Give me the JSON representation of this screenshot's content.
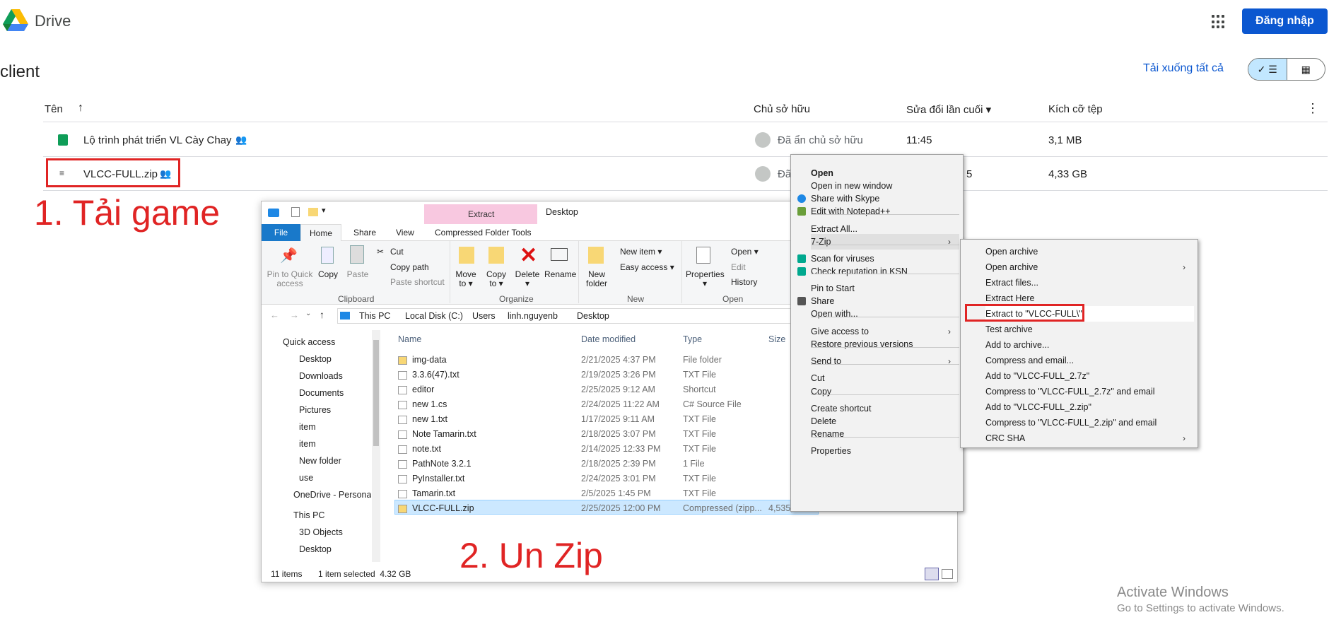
{
  "drive": {
    "brand": "Drive",
    "login": "Đăng nhập",
    "folder_title": "client",
    "download_all": "Tải xuống tất cả",
    "view_list_icon": "✓ ☰",
    "view_grid_icon": "▦"
  },
  "table": {
    "headers": {
      "name": "Tên",
      "sort_arrow": "↑",
      "owner": "Chủ sở hữu",
      "modified": "Sửa đổi lần cuối ▾",
      "size": "Kích cỡ tệp",
      "more": "⋮"
    },
    "rows": [
      {
        "name": "Lộ trình phát triển VL Cày Chay",
        "owner": "Đã ẩn chủ sở hữu",
        "modified": "11:45",
        "size": "3,1 MB"
      },
      {
        "name": "VLCC-FULL.zip",
        "owner": "Đã",
        "modified": "5",
        "size": "4,33 GB"
      }
    ]
  },
  "annotations": {
    "step1": "1. Tải game",
    "step2": "2. Un Zip"
  },
  "explorer": {
    "title": "Desktop",
    "extract_context": "Extract",
    "tabs": [
      "File",
      "Home",
      "Share",
      "View",
      "Compressed Folder Tools"
    ],
    "ribbon": {
      "pin": "Pin to Quick access",
      "copy": "Copy",
      "paste": "Paste",
      "cut": "Cut",
      "copy_path": "Copy path",
      "paste_shortcut": "Paste shortcut",
      "clipboard": "Clipboard",
      "move_to": "Move to ▾",
      "copy_to": "Copy to ▾",
      "delete": "Delete ▾",
      "rename": "Rename",
      "organize": "Organize",
      "new_folder": "New folder",
      "new_item": "New item ▾",
      "easy_access": "Easy access ▾",
      "new": "New",
      "properties": "Properties ▾",
      "open": "Open ▾",
      "edit": "Edit",
      "history": "History",
      "open_group": "Open"
    },
    "address": [
      "This PC",
      "Local Disk (C:)",
      "Users",
      "linh.nguyenb",
      "Desktop"
    ],
    "nav": [
      "Quick access",
      "Desktop",
      "Downloads",
      "Documents",
      "Pictures",
      "item",
      "item",
      "New folder",
      "use",
      "OneDrive - Personal",
      "This PC",
      "3D Objects",
      "Desktop"
    ],
    "columns": {
      "name": "Name",
      "date": "Date modified",
      "type": "Type",
      "size": "Size"
    },
    "files": [
      {
        "name": "img-data",
        "date": "2/21/2025 4:37 PM",
        "type": "File folder",
        "size": ""
      },
      {
        "name": "3.3.6(47).txt",
        "date": "2/19/2025 3:26 PM",
        "type": "TXT File",
        "size": ""
      },
      {
        "name": "editor",
        "date": "2/25/2025 9:12 AM",
        "type": "Shortcut",
        "size": ""
      },
      {
        "name": "new 1.cs",
        "date": "2/24/2025 11:22 AM",
        "type": "C# Source File",
        "size": ""
      },
      {
        "name": "new 1.txt",
        "date": "1/17/2025 9:11 AM",
        "type": "TXT File",
        "size": ""
      },
      {
        "name": "Note Tamarin.txt",
        "date": "2/18/2025 3:07 PM",
        "type": "TXT File",
        "size": ""
      },
      {
        "name": "note.txt",
        "date": "2/14/2025 12:33 PM",
        "type": "TXT File",
        "size": ""
      },
      {
        "name": "PathNote 3.2.1",
        "date": "2/18/2025 2:39 PM",
        "type": "1 File",
        "size": ""
      },
      {
        "name": "PyInstaller.txt",
        "date": "2/24/2025 3:01 PM",
        "type": "TXT File",
        "size": ""
      },
      {
        "name": "Tamarin.txt",
        "date": "2/5/2025 1:45 PM",
        "type": "TXT File",
        "size": ""
      },
      {
        "name": "VLCC-FULL.zip",
        "date": "2/25/2025 12:00 PM",
        "type": "Compressed (zipp...",
        "size": "4,535,..."
      }
    ],
    "status": {
      "items": "11 items",
      "selected": "1 item selected  4.32 GB"
    }
  },
  "context_menu": [
    "Open",
    "Open in new window",
    "Share with Skype",
    "Edit with Notepad++",
    "Extract All...",
    "7-Zip",
    "Scan for viruses",
    "Check reputation in KSN",
    "Pin to Start",
    "Share",
    "Open with...",
    "Give access to",
    "Restore previous versions",
    "Send to",
    "Cut",
    "Copy",
    "Create shortcut",
    "Delete",
    "Rename",
    "Properties"
  ],
  "submenu": [
    "Open archive",
    "Open archive",
    "Extract files...",
    "Extract Here",
    "Extract to \"VLCC-FULL\\\"",
    "Test archive",
    "Add to archive...",
    "Compress and email...",
    "Add to \"VLCC-FULL_2.7z\"",
    "Compress to \"VLCC-FULL_2.7z\" and email",
    "Add to \"VLCC-FULL_2.zip\"",
    "Compress to \"VLCC-FULL_2.zip\" and email",
    "CRC SHA"
  ],
  "watermark": {
    "line1": "Activate Windows",
    "line2": "Go to Settings to activate Windows."
  },
  "colors": {
    "accent": "#0b57d0",
    "annotation": "#e02424",
    "selection": "#cce8ff"
  }
}
